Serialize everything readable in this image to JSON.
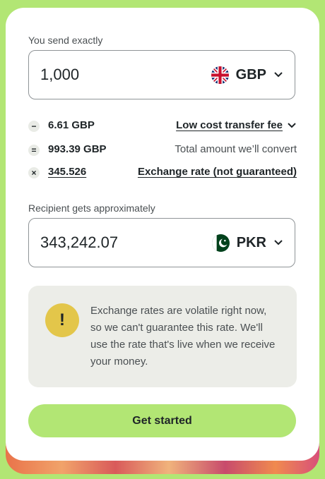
{
  "send": {
    "label": "You send exactly",
    "amount": "1,000",
    "currency": "GBP",
    "currency_icon": "uk-flag-icon"
  },
  "breakdown": {
    "fee_amount": "6.61 GBP",
    "fee_label": "Low cost transfer fee",
    "convert_amount": "993.39 GBP",
    "convert_label": "Total amount we’ll convert",
    "rate_value": "345.526",
    "rate_label": "Exchange rate (not guaranteed)",
    "ops": [
      "−",
      "=",
      "×"
    ]
  },
  "receive": {
    "label": "Recipient gets approximately",
    "amount": "343,242.07",
    "currency": "PKR",
    "currency_icon": "pakistan-flag-icon"
  },
  "warning": {
    "icon": "!",
    "text": "Exchange rates are volatile right now, so we can't guarantee this rate. We'll use the rate that's live when we receive your money."
  },
  "cta": {
    "label": "Get started"
  },
  "colors": {
    "page_background": "#b2e674",
    "cta_background": "#b2e674",
    "warning_icon": "#e3c64a",
    "warning_box": "#ecede8",
    "text_primary": "#1e2427"
  }
}
